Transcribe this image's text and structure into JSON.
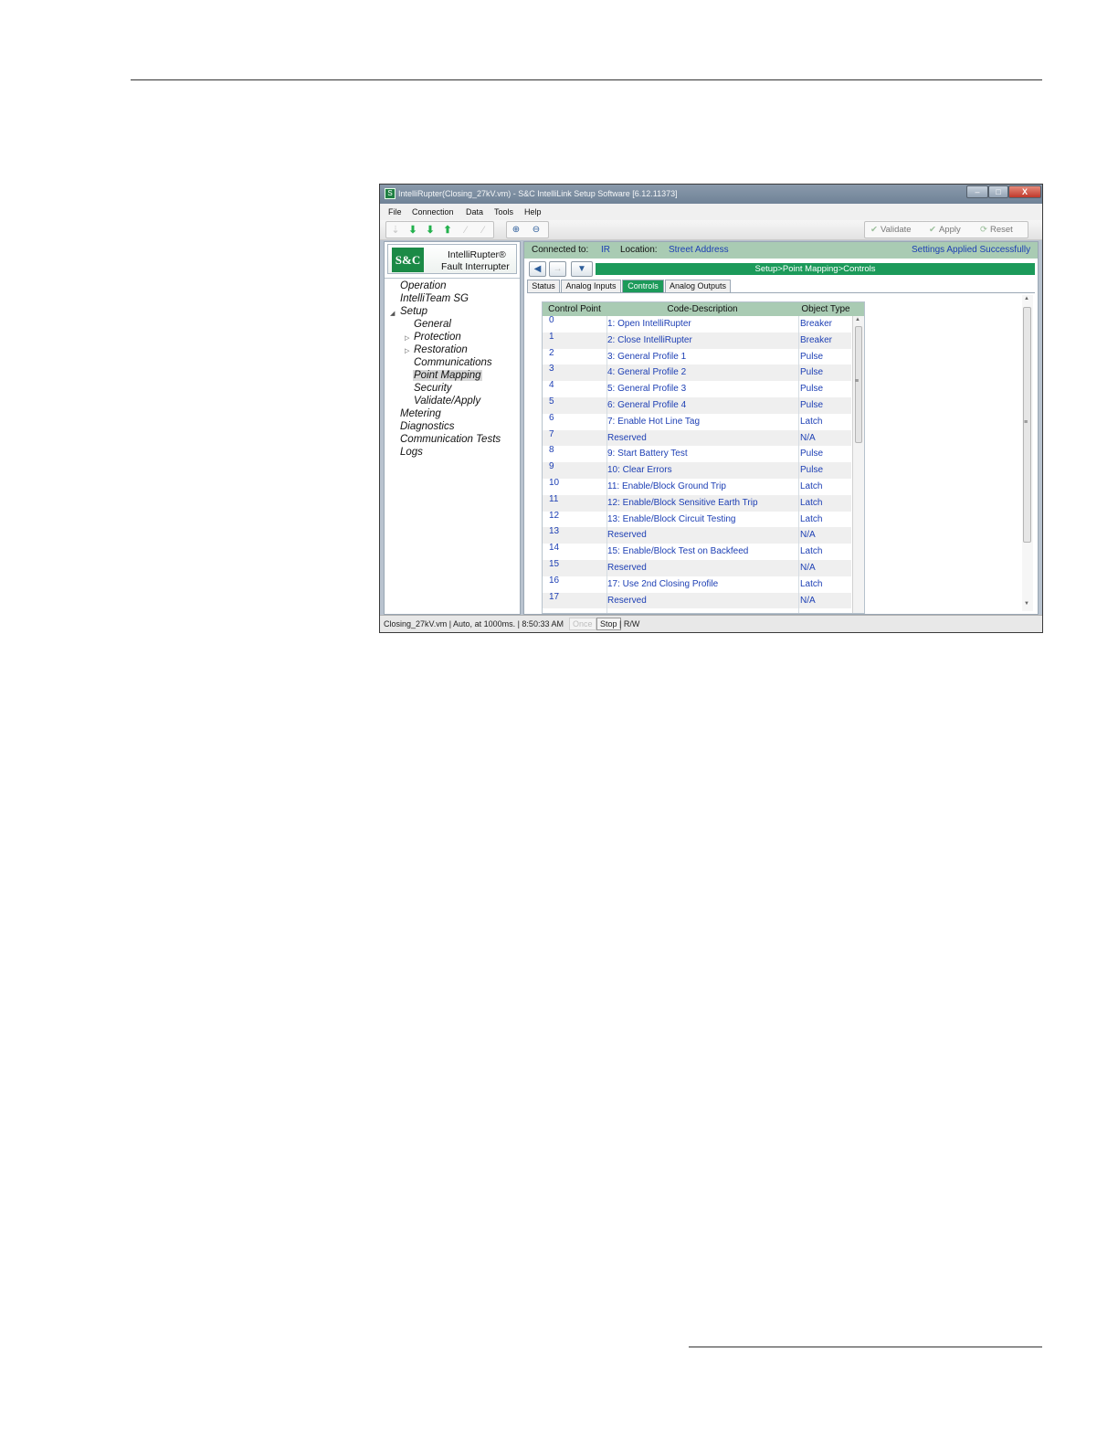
{
  "window": {
    "title": "IntelliRupter(Closing_27kV.vm) - S&C IntelliLink Setup Software [6.12.11373]",
    "app_icon_glyph": "S&C"
  },
  "menu": [
    "File",
    "Connection",
    "Data",
    "Tools",
    "Help"
  ],
  "toolbar": {
    "validate_label": "Validate",
    "apply_label": "Apply",
    "reset_label": "Reset"
  },
  "sidebar": {
    "logo_mark": "S&C",
    "product_line1": "IntelliRupter®",
    "product_line2": "Fault Interrupter",
    "items": [
      {
        "label": "Operation"
      },
      {
        "label": "IntelliTeam SG"
      },
      {
        "label": "Setup"
      },
      {
        "label": "General"
      },
      {
        "label": "Protection"
      },
      {
        "label": "Restoration"
      },
      {
        "label": "Communications"
      },
      {
        "label": "Point Mapping"
      },
      {
        "label": "Security"
      },
      {
        "label": "Validate/Apply"
      },
      {
        "label": "Metering"
      },
      {
        "label": "Diagnostics"
      },
      {
        "label": "Communication Tests"
      },
      {
        "label": "Logs"
      }
    ]
  },
  "connection": {
    "connected_label": "Connected to:",
    "connected_value": "IR",
    "location_label": "Location:",
    "location_value": "Street Address",
    "status_message": "Settings Applied Successfully"
  },
  "breadcrumb": "Setup>Point Mapping>Controls",
  "tabs": [
    {
      "label": "Status"
    },
    {
      "label": "Analog Inputs"
    },
    {
      "label": "Controls"
    },
    {
      "label": "Analog Outputs"
    }
  ],
  "table": {
    "headers": [
      "Control Point",
      "Code-Description",
      "Object Type"
    ],
    "rows": [
      {
        "point": "0",
        "desc": "1: Open IntelliRupter",
        "type": "Breaker"
      },
      {
        "point": "1",
        "desc": "2: Close IntelliRupter",
        "type": "Breaker"
      },
      {
        "point": "2",
        "desc": "3: General Profile 1",
        "type": "Pulse"
      },
      {
        "point": "3",
        "desc": "4: General Profile 2",
        "type": "Pulse"
      },
      {
        "point": "4",
        "desc": "5: General Profile 3",
        "type": "Pulse"
      },
      {
        "point": "5",
        "desc": "6: General Profile 4",
        "type": "Pulse"
      },
      {
        "point": "6",
        "desc": "7: Enable Hot Line Tag",
        "type": "Latch"
      },
      {
        "point": "7",
        "desc": "Reserved",
        "type": "N/A"
      },
      {
        "point": "8",
        "desc": "9: Start Battery Test",
        "type": "Pulse"
      },
      {
        "point": "9",
        "desc": "10: Clear Errors",
        "type": "Pulse"
      },
      {
        "point": "10",
        "desc": "11: Enable/Block Ground Trip",
        "type": "Latch"
      },
      {
        "point": "11",
        "desc": "12: Enable/Block Sensitive Earth Trip",
        "type": "Latch"
      },
      {
        "point": "12",
        "desc": "13: Enable/Block Circuit Testing",
        "type": "Latch"
      },
      {
        "point": "13",
        "desc": "Reserved",
        "type": "N/A"
      },
      {
        "point": "14",
        "desc": "15: Enable/Block Test on Backfeed",
        "type": "Latch"
      },
      {
        "point": "15",
        "desc": "Reserved",
        "type": "N/A"
      },
      {
        "point": "16",
        "desc": "17: Use 2nd Closing Profile",
        "type": "Latch"
      },
      {
        "point": "17",
        "desc": "Reserved",
        "type": "N/A"
      }
    ]
  },
  "statusbar": {
    "text": "Closing_27kV.vm | Auto, at 1000ms. | 8:50:33 AM",
    "once_label": "Once",
    "stop_label": "Stop",
    "mode": "| R/W"
  },
  "colors": {
    "accent_green": "#1c9a5a",
    "header_green": "#a9cbb3",
    "link_blue": "#1d3fb4"
  }
}
